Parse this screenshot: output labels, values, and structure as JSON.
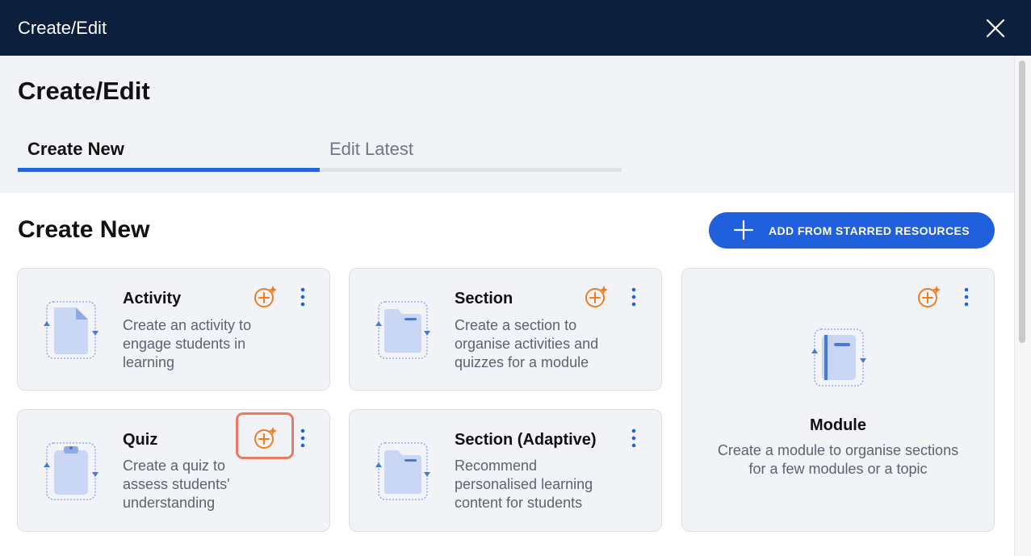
{
  "window": {
    "title": "Create/Edit"
  },
  "page": {
    "heading": "Create/Edit"
  },
  "tabs": [
    {
      "label": "Create New",
      "active": true
    },
    {
      "label": "Edit Latest",
      "active": false
    }
  ],
  "create_new": {
    "heading": "Create New",
    "starred_button_label": "ADD FROM STARRED RESOURCES",
    "cards": [
      {
        "title": "Activity",
        "description": [
          "Create an activity to",
          "engage students in",
          "learning"
        ],
        "icon": "document-icon"
      },
      {
        "title": "Section",
        "description": [
          "Create a section to",
          "organise activities and",
          "quizzes for a module"
        ],
        "icon": "folder-icon"
      },
      {
        "title": "Module",
        "description": [
          "Create a module to organise sections",
          "for a few modules or a topic"
        ],
        "icon": "notebook-icon"
      },
      {
        "title": "Quiz",
        "description": [
          "Create a quiz to",
          "assess students'",
          "understanding"
        ],
        "icon": "clipboard-icon"
      },
      {
        "title": "Section (Adaptive)",
        "description": [
          "Recommend",
          "personalised learning",
          "content for students"
        ],
        "icon": "folder-icon"
      }
    ]
  },
  "colors": {
    "titlebar": "#0c1f3c",
    "accent": "#2060dc",
    "add_star": "#f07c22",
    "highlight": "#e97a66"
  }
}
